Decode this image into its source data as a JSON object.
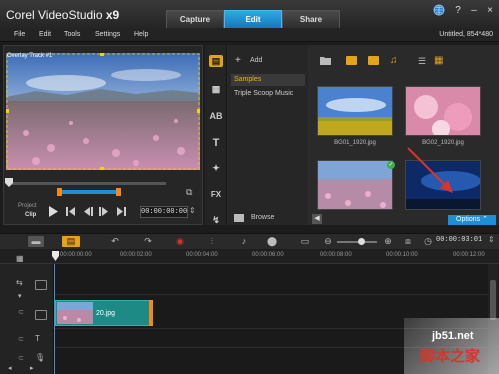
{
  "app": {
    "title_prefix": "Corel VideoStudio ",
    "title_suffix": "x9"
  },
  "tabs": [
    {
      "label": "Capture"
    },
    {
      "label": "Edit"
    },
    {
      "label": "Share"
    }
  ],
  "menu": [
    {
      "label": "File"
    },
    {
      "label": "Edit"
    },
    {
      "label": "Tools"
    },
    {
      "label": "Settings"
    },
    {
      "label": "Help"
    }
  ],
  "project_info": "Untitled, 854*480",
  "player": {
    "overlay_label": "Overlay Track #1",
    "project_label": "Project",
    "clip_label": "Clip",
    "timecode": "00:00:00:00"
  },
  "library": {
    "add_label": "Add",
    "folders": [
      {
        "label": "Samples"
      },
      {
        "label": "Triple Scoop Music"
      }
    ],
    "browse_label": "Browse",
    "options_label": "Options",
    "thumbnails": [
      {
        "label": "BG01_1920.jpg"
      },
      {
        "label": "BG02_1920.jpg"
      },
      {
        "label": ""
      },
      {
        "label": ""
      }
    ]
  },
  "timeline": {
    "timecode": "00:00:03:01",
    "ruler": [
      "00:00:00:00",
      "00:00:02:00",
      "00:00:04:00",
      "00:00:06:00",
      "00:00:08:00",
      "00:00:10:00",
      "00:00:12:00"
    ],
    "clip_label": "20.jpg"
  },
  "watermark": {
    "line1": "jb51.net",
    "line2": "脚本之家"
  },
  "colors": {
    "accent": "#1e8ed6",
    "clip": "#1e8a86",
    "arrow": "#d9342b"
  }
}
